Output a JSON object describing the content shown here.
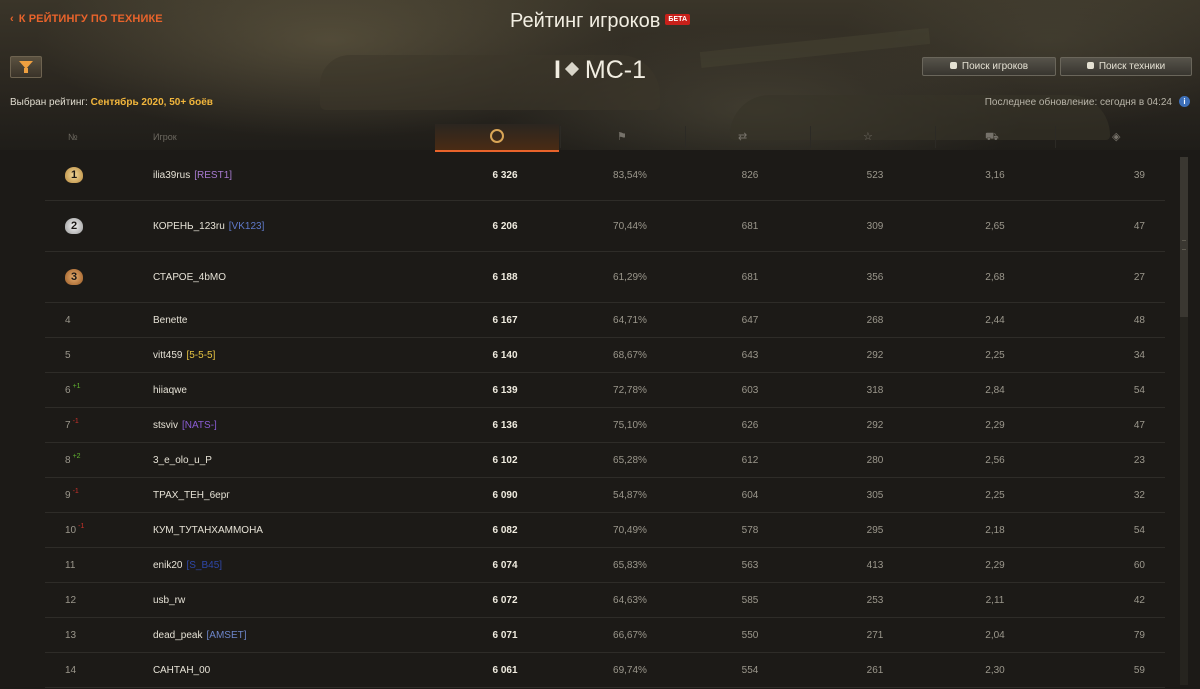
{
  "header": {
    "back_link": "К РЕЙТИНГУ ПО ТЕХНИКЕ",
    "title": "Рейтинг игроков",
    "beta_badge": "БЕТА",
    "vehicle_tier": "I",
    "vehicle_name": "МС-1",
    "search_players_label": "Поиск игроков",
    "search_vehicles_label": "Поиск техники",
    "selected_rating_label": "Выбран рейтинг:",
    "selected_rating_value": "Сентябрь 2020, 50+ боёв",
    "last_update": "Последнее обновление: сегодня в 04:24"
  },
  "table": {
    "headers": {
      "rank": "№",
      "player": "Игрок"
    },
    "rows": [
      {
        "rank": "1",
        "player": "ilia39rus",
        "clan": "[REST1]",
        "clan_color": "#a77ad0",
        "delta": "",
        "delta_dir": "",
        "score": "6 326",
        "win_rate": "83,54%",
        "battles": "826",
        "damage": "523",
        "frags": "3,16",
        "spotted": "39"
      },
      {
        "rank": "2",
        "player": "КОРЕНЬ_123ru",
        "clan": "[VK123]",
        "clan_color": "#5f79c9",
        "delta": "",
        "delta_dir": "",
        "score": "6 206",
        "win_rate": "70,44%",
        "battles": "681",
        "damage": "309",
        "frags": "2,65",
        "spotted": "47"
      },
      {
        "rank": "3",
        "player": "СТАРОЕ_4bMO",
        "clan": "",
        "clan_color": "",
        "delta": "",
        "delta_dir": "",
        "score": "6 188",
        "win_rate": "61,29%",
        "battles": "681",
        "damage": "356",
        "frags": "2,68",
        "spotted": "27"
      },
      {
        "rank": "4",
        "player": "Benette",
        "clan": "",
        "clan_color": "",
        "delta": "",
        "delta_dir": "",
        "score": "6 167",
        "win_rate": "64,71%",
        "battles": "647",
        "damage": "268",
        "frags": "2,44",
        "spotted": "48"
      },
      {
        "rank": "5",
        "player": "vitt459",
        "clan": "[5-5-5]",
        "clan_color": "#e6c442",
        "delta": "",
        "delta_dir": "",
        "score": "6 140",
        "win_rate": "68,67%",
        "battles": "643",
        "damage": "292",
        "frags": "2,25",
        "spotted": "34"
      },
      {
        "rank": "6",
        "player": "hiiaqwe",
        "clan": "",
        "clan_color": "",
        "delta": "+1",
        "delta_dir": "up",
        "score": "6 139",
        "win_rate": "72,78%",
        "battles": "603",
        "damage": "318",
        "frags": "2,84",
        "spotted": "54"
      },
      {
        "rank": "7",
        "player": "stsviv",
        "clan": "[NATS-]",
        "clan_color": "#8a5cd4",
        "delta": "-1",
        "delta_dir": "down",
        "score": "6 136",
        "win_rate": "75,10%",
        "battles": "626",
        "damage": "292",
        "frags": "2,29",
        "spotted": "47"
      },
      {
        "rank": "8",
        "player": "3_e_olo_u_P",
        "clan": "",
        "clan_color": "",
        "delta": "+2",
        "delta_dir": "up",
        "score": "6 102",
        "win_rate": "65,28%",
        "battles": "612",
        "damage": "280",
        "frags": "2,56",
        "spotted": "23"
      },
      {
        "rank": "9",
        "player": "ТРАХ_ТЕН_6ерг",
        "clan": "",
        "clan_color": "",
        "delta": "-1",
        "delta_dir": "down",
        "score": "6 090",
        "win_rate": "54,87%",
        "battles": "604",
        "damage": "305",
        "frags": "2,25",
        "spotted": "32"
      },
      {
        "rank": "10",
        "player": "КУМ_ТУТАНХАММОНА",
        "clan": "",
        "clan_color": "",
        "delta": "-1",
        "delta_dir": "down",
        "score": "6 082",
        "win_rate": "70,49%",
        "battles": "578",
        "damage": "295",
        "frags": "2,18",
        "spotted": "54"
      },
      {
        "rank": "11",
        "player": "enik20",
        "clan": "[S_B45]",
        "clan_color": "#2e47a8",
        "delta": "",
        "delta_dir": "",
        "score": "6 074",
        "win_rate": "65,83%",
        "battles": "563",
        "damage": "413",
        "frags": "2,29",
        "spotted": "60"
      },
      {
        "rank": "12",
        "player": "usb_rw",
        "clan": "",
        "clan_color": "",
        "delta": "",
        "delta_dir": "",
        "score": "6 072",
        "win_rate": "64,63%",
        "battles": "585",
        "damage": "253",
        "frags": "2,11",
        "spotted": "42"
      },
      {
        "rank": "13",
        "player": "dead_peak",
        "clan": "[AMSET]",
        "clan_color": "#6d86c9",
        "delta": "",
        "delta_dir": "",
        "score": "6 071",
        "win_rate": "66,67%",
        "battles": "550",
        "damage": "271",
        "frags": "2,04",
        "spotted": "79"
      },
      {
        "rank": "14",
        "player": "САНТАН_00",
        "clan": "",
        "clan_color": "",
        "delta": "",
        "delta_dir": "",
        "score": "6 061",
        "win_rate": "69,74%",
        "battles": "554",
        "damage": "261",
        "frags": "2,30",
        "spotted": "59"
      }
    ]
  },
  "colors": {
    "accent": "#e8632b",
    "rating_value": "#f2b63c",
    "delta_up": "#62b531",
    "delta_down": "#c8322a"
  },
  "icons": [
    "filter-icon",
    "back-chevron-icon",
    "player-search-icon",
    "vehicle-search-icon",
    "info-icon",
    "medal-icon",
    "flag-icon",
    "battles-icon",
    "damage-star-icon",
    "frags-tank-icon",
    "spotted-eye-icon"
  ]
}
